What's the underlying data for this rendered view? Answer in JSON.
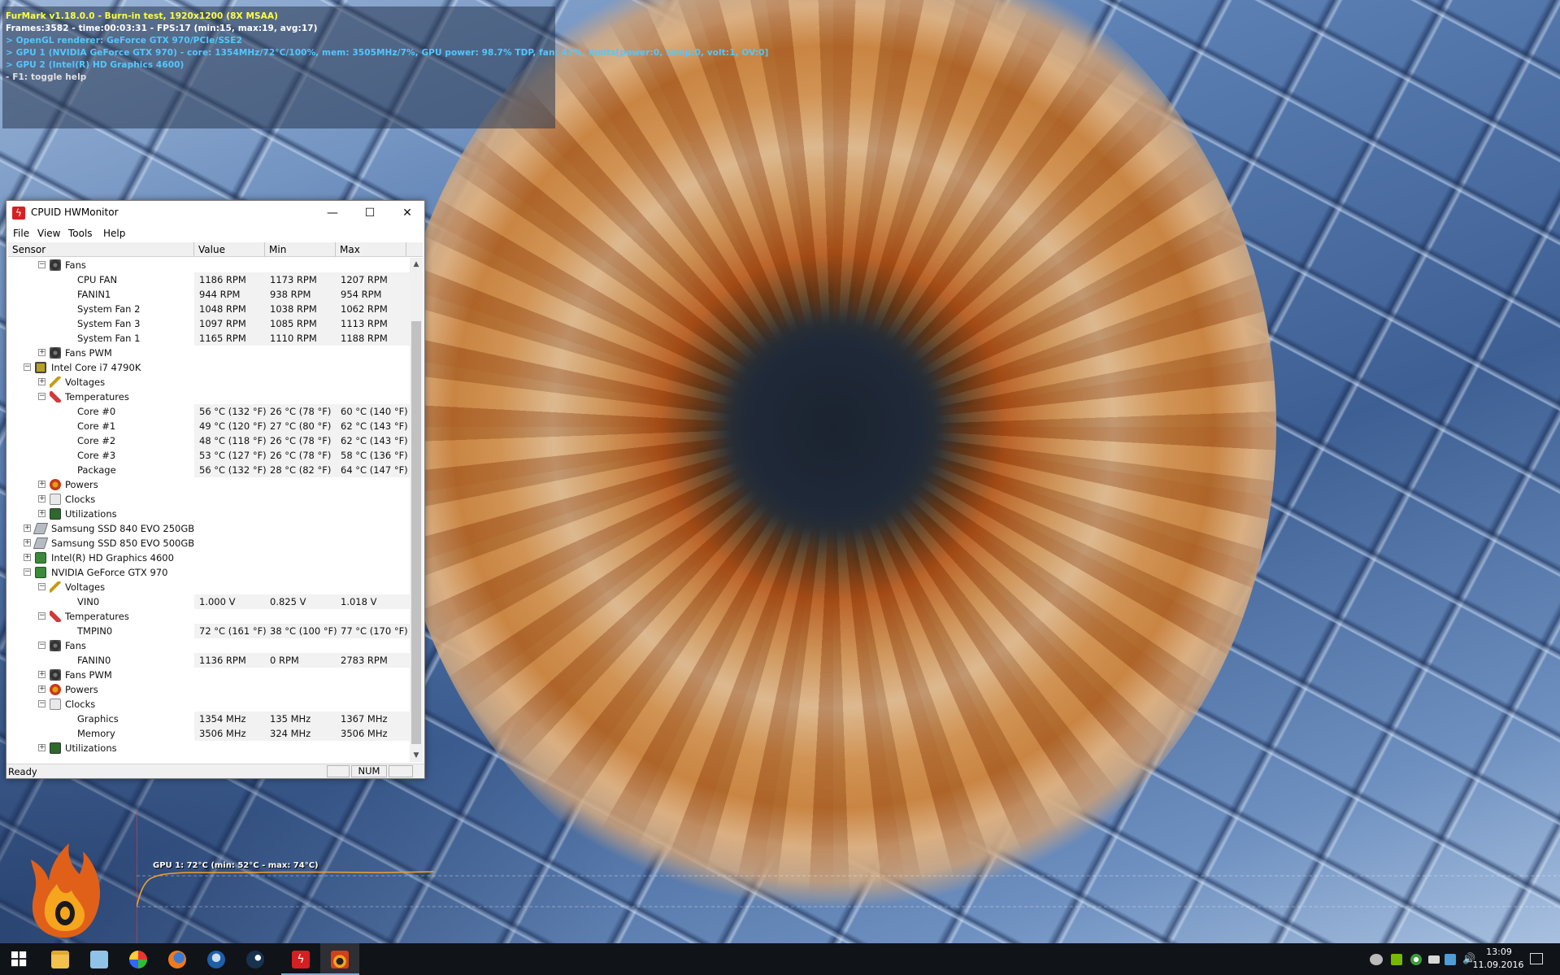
{
  "furmark_osd": {
    "line1": "FurMark v1.18.0.0 - Burn-in test, 1920x1200 (8X MSAA)",
    "line2": "Frames:3582 - time:00:03:31 - FPS:17 (min:15, max:19, avg:17)",
    "line3": "> OpenGL renderer: GeForce GTX 970/PCIe/SSE2",
    "line4": "> GPU 1 (NVIDIA GeForce GTX 970) - core: 1354MHz/72°C/100%, mem: 3505MHz/7%, GPU power: 98.7% TDP, fan: 47%, limits[power:0, temp:0, volt:1, OV:0]",
    "line5": "> GPU 2 (Intel(R) HD Graphics 4600)",
    "line6": "- F1: toggle help",
    "graph_label": "GPU 1: 72°C (min: 52°C - max: 74°C)"
  },
  "hwmonitor": {
    "title": "CPUID HWMonitor",
    "menu": [
      "File",
      "View",
      "Tools",
      "Help"
    ],
    "columns": [
      "Sensor",
      "Value",
      "Min",
      "Max"
    ],
    "status": "Ready",
    "status_num": "NUM",
    "rows": [
      {
        "label": "Fans",
        "indent": 2,
        "icon": "fan-icon",
        "expander": "−"
      },
      {
        "label": "CPU FAN",
        "indent": 4,
        "value": "1186 RPM",
        "min": "1173 RPM",
        "max": "1207 RPM"
      },
      {
        "label": "FANIN1",
        "indent": 4,
        "value": "944 RPM",
        "min": "938 RPM",
        "max": "954 RPM"
      },
      {
        "label": "System Fan 2",
        "indent": 4,
        "value": "1048 RPM",
        "min": "1038 RPM",
        "max": "1062 RPM"
      },
      {
        "label": "System Fan 3",
        "indent": 4,
        "value": "1097 RPM",
        "min": "1085 RPM",
        "max": "1113 RPM"
      },
      {
        "label": "System Fan 1",
        "indent": 4,
        "value": "1165 RPM",
        "min": "1110 RPM",
        "max": "1188 RPM"
      },
      {
        "label": "Fans PWM",
        "indent": 2,
        "icon": "fan-icon",
        "expander": "+"
      },
      {
        "label": "Intel Core i7 4790K",
        "indent": 1,
        "icon": "cpu-icon",
        "expander": "−"
      },
      {
        "label": "Voltages",
        "indent": 2,
        "icon": "voltage-icon",
        "expander": "+"
      },
      {
        "label": "Temperatures",
        "indent": 2,
        "icon": "thermometer-icon",
        "expander": "−"
      },
      {
        "label": "Core #0",
        "indent": 4,
        "value": "56 °C  (132 °F)",
        "min": "26 °C  (78 °F)",
        "max": "60 °C  (140 °F)"
      },
      {
        "label": "Core #1",
        "indent": 4,
        "value": "49 °C  (120 °F)",
        "min": "27 °C  (80 °F)",
        "max": "62 °C  (143 °F)"
      },
      {
        "label": "Core #2",
        "indent": 4,
        "value": "48 °C  (118 °F)",
        "min": "26 °C  (78 °F)",
        "max": "62 °C  (143 °F)"
      },
      {
        "label": "Core #3",
        "indent": 4,
        "value": "53 °C  (127 °F)",
        "min": "26 °C  (78 °F)",
        "max": "58 °C  (136 °F)"
      },
      {
        "label": "Package",
        "indent": 4,
        "value": "56 °C  (132 °F)",
        "min": "28 °C  (82 °F)",
        "max": "64 °C  (147 °F)"
      },
      {
        "label": "Powers",
        "indent": 2,
        "icon": "power-icon",
        "expander": "+"
      },
      {
        "label": "Clocks",
        "indent": 2,
        "icon": "clock-icon",
        "expander": "+"
      },
      {
        "label": "Utilizations",
        "indent": 2,
        "icon": "utilization-icon",
        "expander": "+"
      },
      {
        "label": "Samsung SSD 840 EVO 250GB",
        "indent": 1,
        "icon": "drive-icon",
        "expander": "+"
      },
      {
        "label": "Samsung SSD 850 EVO 500GB",
        "indent": 1,
        "icon": "drive-icon",
        "expander": "+"
      },
      {
        "label": "Intel(R) HD Graphics 4600",
        "indent": 1,
        "icon": "gpu-icon",
        "expander": "+"
      },
      {
        "label": "NVIDIA GeForce GTX 970",
        "indent": 1,
        "icon": "gpu-icon",
        "expander": "−"
      },
      {
        "label": "Voltages",
        "indent": 2,
        "icon": "voltage-icon",
        "expander": "−"
      },
      {
        "label": "VIN0",
        "indent": 4,
        "value": "1.000 V",
        "min": "0.825 V",
        "max": "1.018 V"
      },
      {
        "label": "Temperatures",
        "indent": 2,
        "icon": "thermometer-icon",
        "expander": "−"
      },
      {
        "label": "TMPIN0",
        "indent": 4,
        "value": "72 °C  (161 °F)",
        "min": "38 °C  (100 °F)",
        "max": "77 °C  (170 °F)"
      },
      {
        "label": "Fans",
        "indent": 2,
        "icon": "fan-icon",
        "expander": "−"
      },
      {
        "label": "FANIN0",
        "indent": 4,
        "value": "1136 RPM",
        "min": "0 RPM",
        "max": "2783 RPM"
      },
      {
        "label": "Fans PWM",
        "indent": 2,
        "icon": "fan-icon",
        "expander": "+"
      },
      {
        "label": "Powers",
        "indent": 2,
        "icon": "power-icon",
        "expander": "+"
      },
      {
        "label": "Clocks",
        "indent": 2,
        "icon": "clock-icon",
        "expander": "−"
      },
      {
        "label": "Graphics",
        "indent": 4,
        "value": "1354 MHz",
        "min": "135 MHz",
        "max": "1367 MHz"
      },
      {
        "label": "Memory",
        "indent": 4,
        "value": "3506 MHz",
        "min": "324 MHz",
        "max": "3506 MHz"
      },
      {
        "label": "Utilizations",
        "indent": 2,
        "icon": "utilization-icon",
        "expander": "+"
      }
    ]
  },
  "taskbar": {
    "apps": [
      "windows-start-icon",
      "file-explorer-icon",
      "notepad-icon",
      "paint-icon",
      "firefox-icon",
      "thunderbird-icon",
      "steam-icon",
      "hwmonitor-icon",
      "furmark-icon"
    ],
    "clock_time": "13:09",
    "clock_date": "11.09.2016"
  },
  "colors": {
    "osd_yellow": "#ffff40",
    "osd_cyan": "#52c8ff",
    "graph_line": "#f0a030",
    "taskbar": "#101318"
  }
}
